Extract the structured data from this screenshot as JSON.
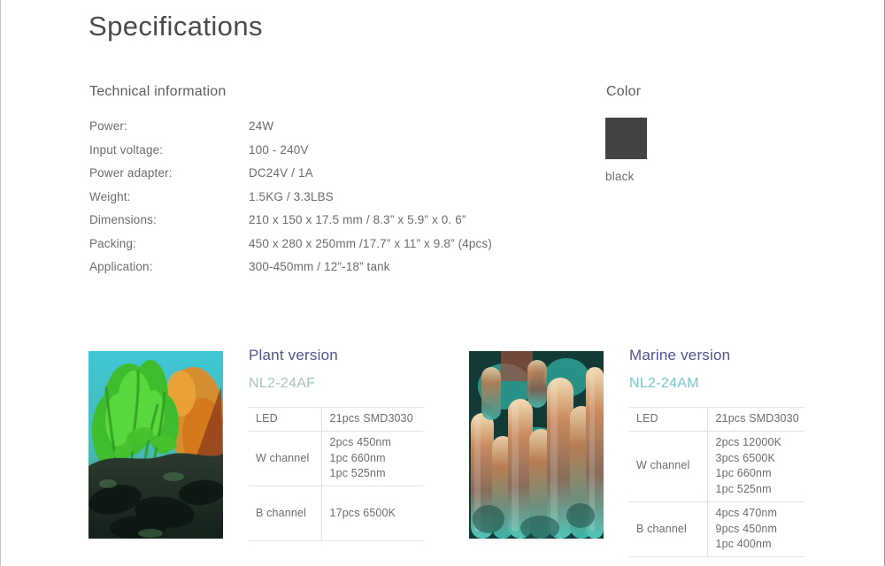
{
  "page": {
    "title": "Specifications"
  },
  "technical": {
    "heading": "Technical information",
    "rows": [
      {
        "label": "Power:",
        "value": "24W"
      },
      {
        "label": "Input voltage:",
        "value": "100 - 240V"
      },
      {
        "label": "Power adapter:",
        "value": "DC24V / 1A"
      },
      {
        "label": "Weight:",
        "value": "1.5KG / 3.3LBS"
      },
      {
        "label": "Dimensions:",
        "value": "210 x 150 x 17.5 mm / 8.3” x  5.9”  x  0. 6”"
      },
      {
        "label": "Packing:",
        "value": "450 x 280 x 250mm /17.7” x 11” x 9.8” (4pcs)"
      },
      {
        "label": "Application:",
        "value": "300-450mm / 12”-18” tank"
      }
    ]
  },
  "color": {
    "heading": "Color",
    "swatch_hex": "#434343",
    "label": "black"
  },
  "versions": [
    {
      "key": "plant",
      "title": "Plant version",
      "model": "NL2-24AF",
      "title_hex": "#4f5391",
      "model_hex": "#a9c5b8",
      "photo_alt": "planted-aquarium-photo",
      "table": [
        {
          "label": "LED",
          "lines": [
            "21pcs SMD3030"
          ]
        },
        {
          "label": "W channel",
          "lines": [
            "2pcs  450nm",
            "1pc  660nm",
            "1pc  525nm"
          ]
        },
        {
          "label": "B channel",
          "lines": [
            "17pcs 6500K"
          ]
        }
      ]
    },
    {
      "key": "marine",
      "title": "Marine version",
      "model": "NL2-24AM",
      "title_hex": "#4f5391",
      "model_hex": "#76c7cb",
      "photo_alt": "coral-reef-photo",
      "table": [
        {
          "label": "LED",
          "lines": [
            "21pcs SMD3030"
          ]
        },
        {
          "label": "W channel",
          "lines": [
            "2pcs 12000K",
            "3pcs 6500K",
            "1pc 660nm",
            "1pc 525nm"
          ]
        },
        {
          "label": "B channel",
          "lines": [
            "4pcs 470nm",
            "9pcs 450nm",
            "1pc 400nm"
          ]
        }
      ]
    }
  ]
}
